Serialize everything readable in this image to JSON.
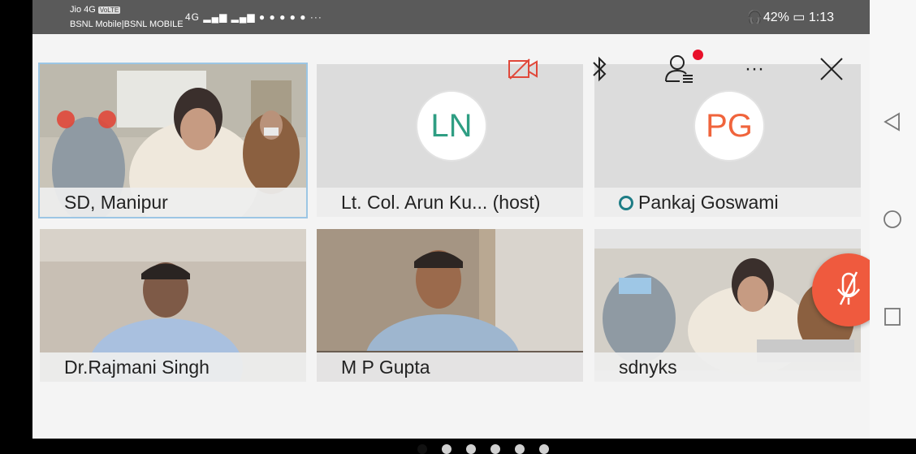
{
  "status_bar": {
    "carrier_line1": "Jio 4G",
    "volte": "VoLTE",
    "carrier_line2": "BSNL Mobile|BSNL MOBILE",
    "network": "4G",
    "more": "···",
    "battery": "42%",
    "time": "1:13"
  },
  "controls": {
    "camera_icon": "camera-off-icon",
    "bluetooth_icon": "bluetooth-icon",
    "participants_icon": "participants-icon",
    "more_label": "···",
    "close_icon": "close-icon"
  },
  "colors": {
    "accent_red": "#e0483a",
    "fab": "#ef5a3e",
    "ln_avatar": "#2f9e83",
    "pg_avatar": "#f0643c"
  },
  "tiles": [
    {
      "name": "SD, Manipur"
    },
    {
      "name": "Lt. Col.  Arun Ku... (host)",
      "initials": "LN"
    },
    {
      "name": "Pankaj Goswami",
      "initials": "PG"
    },
    {
      "name": "Dr.Rajmani Singh"
    },
    {
      "name": "M P Gupta"
    },
    {
      "name": "sdnyks"
    }
  ],
  "pager": {
    "pages": 6,
    "current": 1
  },
  "mic_fab_icon": "mic-off-icon"
}
